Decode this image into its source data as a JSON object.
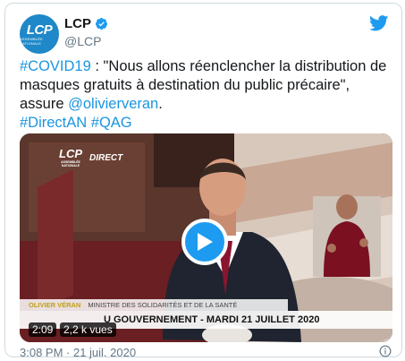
{
  "account": {
    "avatar_text": "LCP",
    "avatar_subtext": "ASSEMBLÉE NATIONALE",
    "name": "LCP",
    "handle": "@LCP"
  },
  "tweet": {
    "hashtag_covid": "#COVID19",
    "text_part1": " : \"Nous allons réenclencher la distribution de masques gratuits à destination du public précaire\", assure ",
    "mention": "@olivierveran",
    "text_part2": ".",
    "hashtag_direct": "#DirectAN",
    "hashtag_qag": "#QAG"
  },
  "video": {
    "channel_logo": "LCP",
    "channel_logo_sub": "ASSEMBLÉE NATIONALE",
    "live_label": "DIRECT",
    "speaker_name": "OLIVIER VÉRAN",
    "speaker_role": "MINISTRE DES SOLIDARITÉS ET DE LA SANTÉ",
    "banner_text": "U GOUVERNEMENT - MARDI 21 JUILLET 2020",
    "duration": "2:09",
    "views": "2,2 k vues"
  },
  "meta": {
    "timestamp": "3:08 PM · 21 juil. 2020"
  },
  "colors": {
    "link": "#1b95e0",
    "brand": "#1e88c8",
    "play": "#1d9bf0"
  },
  "icons": [
    "verified-icon",
    "twitter-bird-icon",
    "play-icon",
    "info-icon"
  ]
}
